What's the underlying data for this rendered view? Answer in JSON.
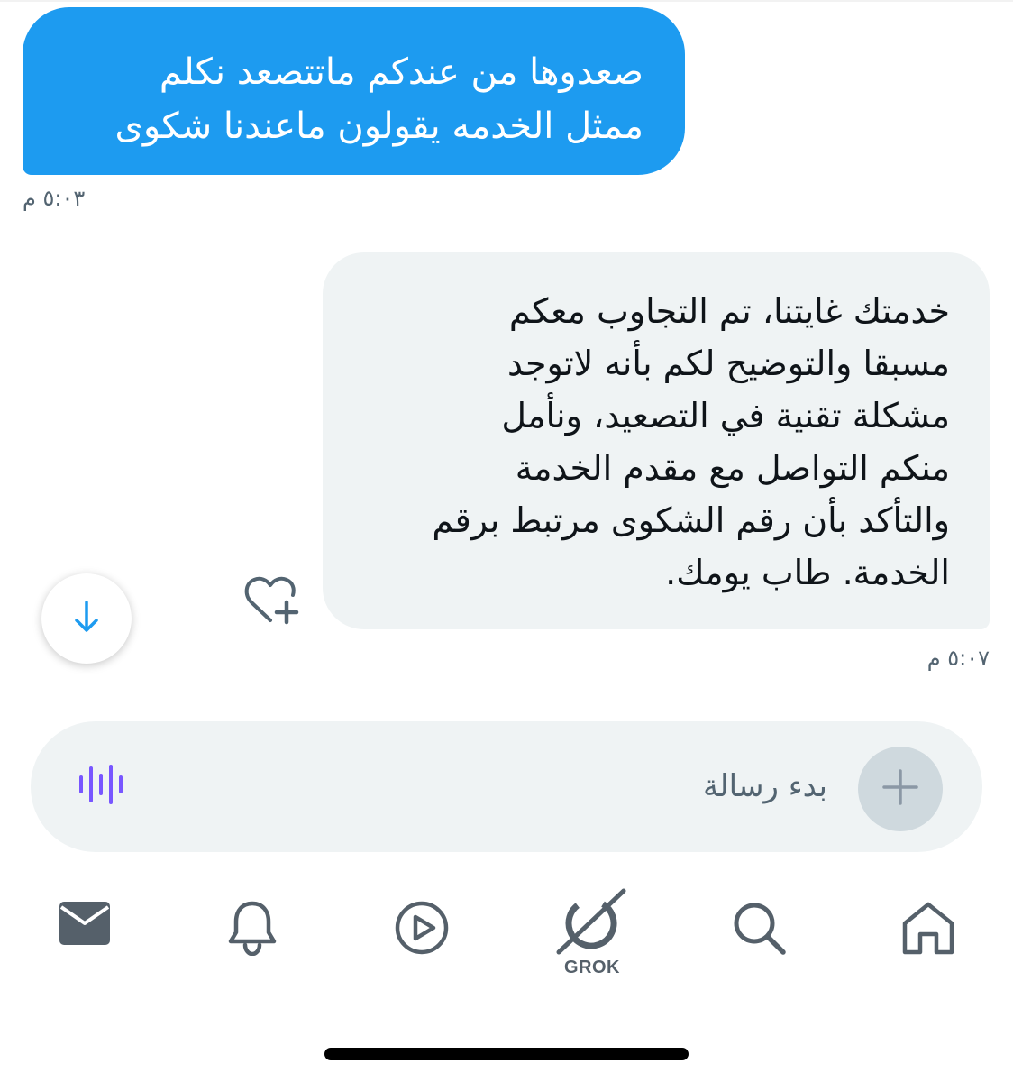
{
  "conversation": {
    "messages": [
      {
        "direction": "sent",
        "text": "صعدوها من عندكم ماتتصعد نكلم\nممثل الخدمه يقولون ماعندنا شكوى",
        "time": "٥:٠٣ م"
      },
      {
        "direction": "received",
        "text": "خدمتك غايتنا، تم التجاوب معكم\nمسبقا والتوضيح لكم بأنه لاتوجد\nمشكلة تقنية في التصعيد، ونأمل\nمنكم التواصل مع مقدم الخدمة\nوالتأكد بأن رقم الشكوى مرتبط برقم\nالخدمة. طاب يومك.",
        "time": "٥:٠٧ م"
      }
    ]
  },
  "composer": {
    "placeholder": "بدء رسالة",
    "add_icon": "plus-icon",
    "voice_icon": "waveform-icon"
  },
  "bottom_nav": {
    "items": [
      {
        "name": "messages",
        "icon": "envelope-icon",
        "active": true
      },
      {
        "name": "notifications",
        "icon": "bell-icon"
      },
      {
        "name": "video",
        "icon": "play-circle-icon"
      },
      {
        "name": "grok",
        "icon": "grok-icon",
        "label": "GROK"
      },
      {
        "name": "search",
        "icon": "search-icon"
      },
      {
        "name": "home",
        "icon": "home-icon"
      }
    ]
  },
  "colors": {
    "accent": "#1d9bf0",
    "bubble_received": "#eff3f4",
    "muted_text": "#536471",
    "voice_accent": "#7856ff"
  }
}
